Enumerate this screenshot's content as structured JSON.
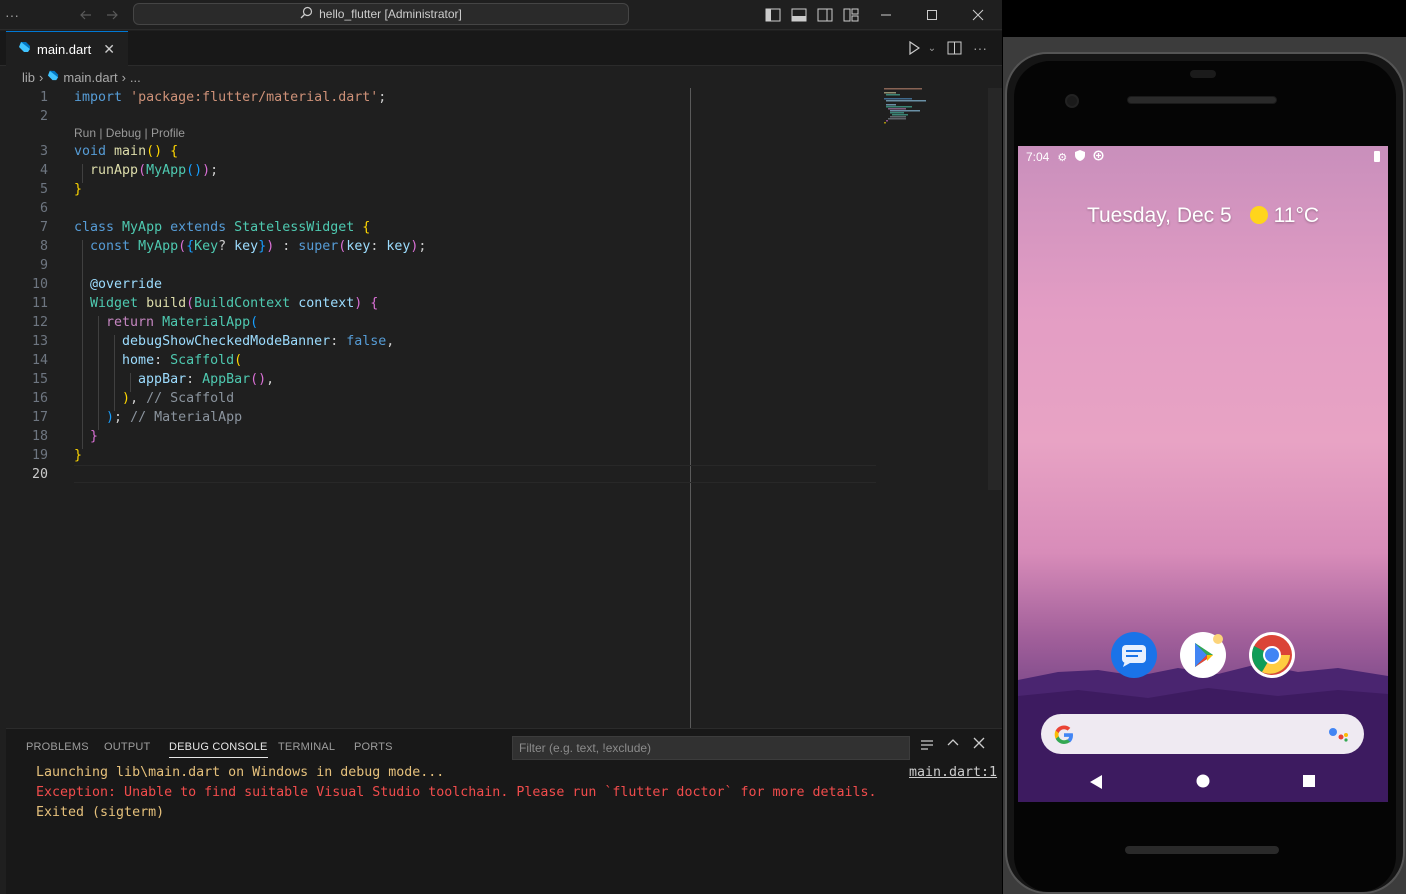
{
  "titlebar": {
    "menu_icon": "ellipsis-icon",
    "search_text": "hello_flutter [Administrator]"
  },
  "tab": {
    "label": "main.dart"
  },
  "breadcrumb": {
    "folder": "lib",
    "file": "main.dart",
    "more": "..."
  },
  "codelens": "Run | Debug | Profile",
  "editor": {
    "active_line": "20",
    "lines": [
      {
        "n": "1"
      },
      {
        "n": "2"
      },
      {
        "n": "3"
      },
      {
        "n": "4"
      },
      {
        "n": "5"
      },
      {
        "n": "6"
      },
      {
        "n": "7"
      },
      {
        "n": "8"
      },
      {
        "n": "9"
      },
      {
        "n": "10"
      },
      {
        "n": "11"
      },
      {
        "n": "12"
      },
      {
        "n": "13"
      },
      {
        "n": "14"
      },
      {
        "n": "15"
      },
      {
        "n": "16"
      },
      {
        "n": "17"
      },
      {
        "n": "18"
      },
      {
        "n": "19"
      },
      {
        "n": "20"
      }
    ],
    "code": {
      "l1_kw": "import",
      "l1_str": "'package:flutter/material.dart'",
      "l3_kw": "void",
      "l3_fn": "main",
      "l4_fn": "runApp",
      "l4_t": "MyApp",
      "l7_kw1": "class",
      "l7_t1": "MyApp",
      "l7_kw2": "extends",
      "l7_t2": "StatelessWidget",
      "l8_kw": "const",
      "l8_t": "MyApp",
      "l8_t2": "Key",
      "l8_p": "key",
      "l8_super": "super",
      "l8_p2": "key",
      "l8_p3": "key",
      "l10_ann": "@override",
      "l11_t": "Widget",
      "l11_fn": "build",
      "l11_t2": "BuildContext",
      "l11_p": "context",
      "l12_kw": "return",
      "l12_t": "MaterialApp",
      "l13_p": "debugShowCheckedModeBanner",
      "l13_v": "false",
      "l14_p": "home",
      "l14_t": "Scaffold",
      "l15_p": "appBar",
      "l15_t": "AppBar",
      "l16_c": "// Scaffold",
      "l17_c": "// MaterialApp"
    }
  },
  "panel": {
    "tabs": [
      "PROBLEMS",
      "OUTPUT",
      "DEBUG CONSOLE",
      "TERMINAL",
      "PORTS"
    ],
    "filter_placeholder": "Filter (e.g. text, !exclude)",
    "console": [
      "Launching lib\\main.dart on Windows in debug mode...",
      "Exception: Unable to find suitable Visual Studio toolchain. Please run `flutter doctor` for more details.",
      "Exited (sigterm)"
    ],
    "source_link": "main.dart:1"
  },
  "emulator": {
    "time": "7:04",
    "date": "Tuesday, Dec 5",
    "temperature": "11°C",
    "apps": [
      "Messages",
      "Play Store",
      "Chrome"
    ]
  },
  "colors": {
    "accent": "#0078d4",
    "error_text": "#f14c4c",
    "info_text": "#e5c07b"
  }
}
